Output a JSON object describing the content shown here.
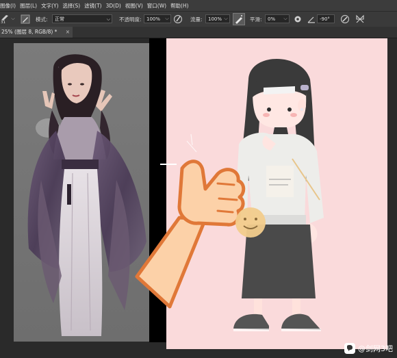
{
  "menubar": {
    "items": [
      "图像(I)",
      "图层(L)",
      "文字(Y)",
      "选择(S)",
      "滤镜(T)",
      "3D(D)",
      "视图(V)",
      "窗口(W)",
      "帮助(H)"
    ]
  },
  "options": {
    "brush_size": "31",
    "mode_label": "模式:",
    "mode_value": "正常",
    "opacity_label": "不透明度:",
    "opacity_value": "100%",
    "flow_label": "流量:",
    "flow_value": "100%",
    "smoothing_label": "平滑:",
    "smoothing_value": "0%",
    "angle_value": "-90°"
  },
  "document_tab": {
    "title": "25% (图层 8, RGB/8) *",
    "close": "×"
  },
  "watermark": {
    "text": "@剑网3吧"
  },
  "colors": {
    "pink_canvas": "#fadadb",
    "thumb_outline": "#e07838",
    "thumb_fill": "#fcd1a8",
    "smiley": "#f2cc8c"
  }
}
